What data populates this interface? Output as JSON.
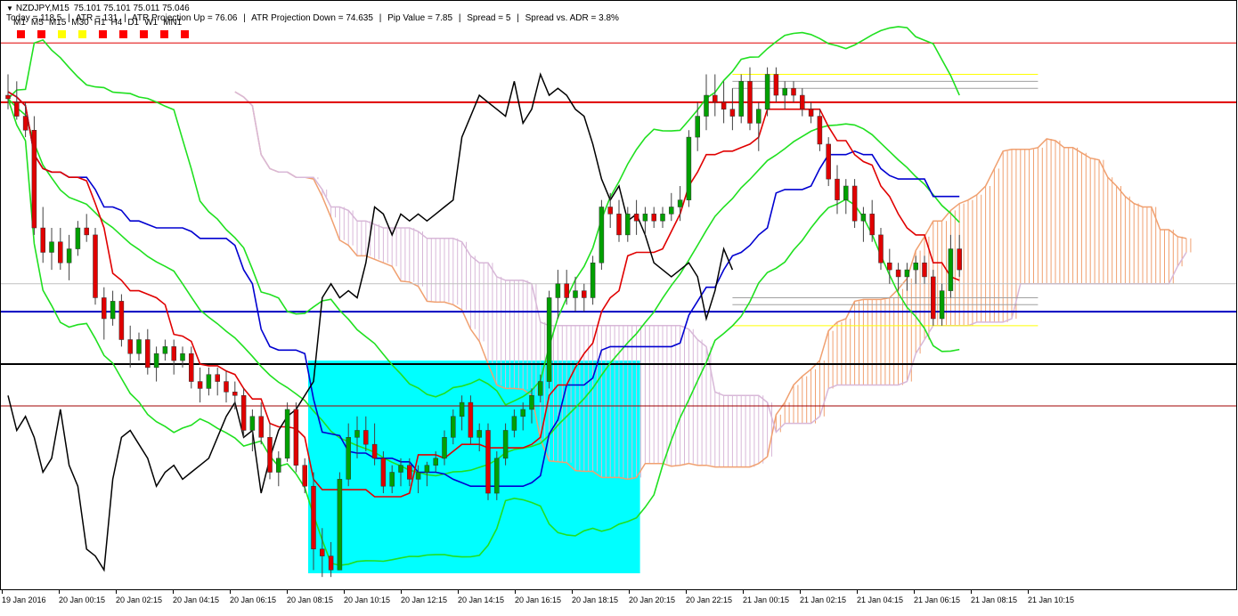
{
  "header": {
    "symbol": "NZDJPY,M15",
    "ohlc": "75.101 75.101 75.011 75.046"
  },
  "stats": {
    "today": "Today = 118.5",
    "atr": "ATR = 131",
    "atr_up": "ATR Projection Up = 76.06",
    "atr_down": "ATR Projection Down = 74.635",
    "pip_value": "Pip Value = 7.85",
    "spread": "Spread = 5",
    "spread_adr": "Spread vs. ADR = 3.8%",
    "separator": "|"
  },
  "timeframes": {
    "labels": [
      "M1",
      "M5",
      "M15",
      "M30",
      "H1",
      "H4",
      "D1",
      "W1",
      "MN1"
    ],
    "colors": [
      "#ff0000",
      "#ff0000",
      "#ffff00",
      "#ffff00",
      "#ff0000",
      "#ff0000",
      "#ff0000",
      "#ff0000",
      "#ff0000"
    ]
  },
  "colors": {
    "bull": "#00a000",
    "bear": "#e00000",
    "kumo_bull": "#f0a070",
    "kumo_bear": "#d8b8d8",
    "kijun": "#0000d0",
    "tenkan": "#e00000",
    "bands": "#20e020",
    "chikou": "#000000",
    "box": "#00ffff"
  },
  "chart_data": {
    "type": "candlestick",
    "symbol": "NZDJPY",
    "timeframe": "M15",
    "y_range": [
      74.6,
      76.25
    ],
    "x_tick_labels": [
      "19 Jan 2016",
      "20 Jan 00:15",
      "20 Jan 02:15",
      "20 Jan 04:15",
      "20 Jan 06:15",
      "20 Jan 08:15",
      "20 Jan 10:15",
      "20 Jan 12:15",
      "20 Jan 14:15",
      "20 Jan 16:15",
      "20 Jan 18:15",
      "20 Jan 20:15",
      "20 Jan 22:15",
      "21 Jan 00:15",
      "21 Jan 02:15",
      "21 Jan 04:15",
      "21 Jan 06:15",
      "21 Jan 08:15",
      "21 Jan 10:15"
    ],
    "candles": [
      {
        "o": 76.0,
        "h": 76.06,
        "l": 75.96,
        "c": 75.99
      },
      {
        "o": 75.98,
        "h": 76.04,
        "l": 75.93,
        "c": 75.94
      },
      {
        "o": 75.94,
        "h": 75.98,
        "l": 75.88,
        "c": 75.9
      },
      {
        "o": 75.9,
        "h": 75.94,
        "l": 75.6,
        "c": 75.62
      },
      {
        "o": 75.62,
        "h": 75.68,
        "l": 75.52,
        "c": 75.55
      },
      {
        "o": 75.55,
        "h": 75.62,
        "l": 75.5,
        "c": 75.58
      },
      {
        "o": 75.58,
        "h": 75.62,
        "l": 75.5,
        "c": 75.52
      },
      {
        "o": 75.52,
        "h": 75.6,
        "l": 75.47,
        "c": 75.56
      },
      {
        "o": 75.56,
        "h": 75.64,
        "l": 75.54,
        "c": 75.62
      },
      {
        "o": 75.62,
        "h": 75.66,
        "l": 75.58,
        "c": 75.6
      },
      {
        "o": 75.6,
        "h": 75.62,
        "l": 75.4,
        "c": 75.42
      },
      {
        "o": 75.42,
        "h": 75.45,
        "l": 75.3,
        "c": 75.36
      },
      {
        "o": 75.36,
        "h": 75.44,
        "l": 75.34,
        "c": 75.41
      },
      {
        "o": 75.41,
        "h": 75.43,
        "l": 75.28,
        "c": 75.3
      },
      {
        "o": 75.3,
        "h": 75.34,
        "l": 75.22,
        "c": 75.26
      },
      {
        "o": 75.26,
        "h": 75.32,
        "l": 75.24,
        "c": 75.3
      },
      {
        "o": 75.3,
        "h": 75.33,
        "l": 75.2,
        "c": 75.22
      },
      {
        "o": 75.22,
        "h": 75.28,
        "l": 75.18,
        "c": 75.26
      },
      {
        "o": 75.26,
        "h": 75.3,
        "l": 75.24,
        "c": 75.28
      },
      {
        "o": 75.28,
        "h": 75.3,
        "l": 75.2,
        "c": 75.24
      },
      {
        "o": 75.24,
        "h": 75.28,
        "l": 75.22,
        "c": 75.26
      },
      {
        "o": 75.26,
        "h": 75.28,
        "l": 75.16,
        "c": 75.18
      },
      {
        "o": 75.18,
        "h": 75.22,
        "l": 75.12,
        "c": 75.16
      },
      {
        "o": 75.16,
        "h": 75.22,
        "l": 75.14,
        "c": 75.2
      },
      {
        "o": 75.2,
        "h": 75.22,
        "l": 75.14,
        "c": 75.18
      },
      {
        "o": 75.18,
        "h": 75.21,
        "l": 75.12,
        "c": 75.15
      },
      {
        "o": 75.15,
        "h": 75.18,
        "l": 75.1,
        "c": 75.14
      },
      {
        "o": 75.14,
        "h": 75.16,
        "l": 75.02,
        "c": 75.04
      },
      {
        "o": 75.04,
        "h": 75.1,
        "l": 74.98,
        "c": 75.08
      },
      {
        "o": 75.08,
        "h": 75.12,
        "l": 75.0,
        "c": 75.02
      },
      {
        "o": 75.02,
        "h": 75.06,
        "l": 74.9,
        "c": 74.92
      },
      {
        "o": 74.92,
        "h": 74.98,
        "l": 74.88,
        "c": 74.96
      },
      {
        "o": 74.96,
        "h": 75.12,
        "l": 74.95,
        "c": 75.1
      },
      {
        "o": 75.1,
        "h": 75.12,
        "l": 74.92,
        "c": 74.94
      },
      {
        "o": 74.94,
        "h": 74.96,
        "l": 74.86,
        "c": 74.88
      },
      {
        "o": 74.88,
        "h": 74.92,
        "l": 74.64,
        "c": 74.7
      },
      {
        "o": 74.7,
        "h": 74.76,
        "l": 74.62,
        "c": 74.68
      },
      {
        "o": 74.68,
        "h": 74.72,
        "l": 74.62,
        "c": 74.64
      },
      {
        "o": 74.64,
        "h": 74.92,
        "l": 74.64,
        "c": 74.9
      },
      {
        "o": 74.9,
        "h": 75.06,
        "l": 74.88,
        "c": 75.02
      },
      {
        "o": 75.02,
        "h": 75.08,
        "l": 74.96,
        "c": 75.04
      },
      {
        "o": 75.04,
        "h": 75.08,
        "l": 74.98,
        "c": 75.0
      },
      {
        "o": 75.0,
        "h": 75.06,
        "l": 74.94,
        "c": 74.96
      },
      {
        "o": 74.96,
        "h": 74.98,
        "l": 74.86,
        "c": 74.88
      },
      {
        "o": 74.88,
        "h": 74.94,
        "l": 74.86,
        "c": 74.92
      },
      {
        "o": 74.92,
        "h": 74.96,
        "l": 74.88,
        "c": 74.94
      },
      {
        "o": 74.94,
        "h": 74.96,
        "l": 74.88,
        "c": 74.9
      },
      {
        "o": 74.9,
        "h": 74.94,
        "l": 74.86,
        "c": 74.92
      },
      {
        "o": 74.92,
        "h": 74.95,
        "l": 74.88,
        "c": 74.94
      },
      {
        "o": 74.94,
        "h": 74.98,
        "l": 74.92,
        "c": 74.96
      },
      {
        "o": 74.96,
        "h": 75.04,
        "l": 74.94,
        "c": 75.02
      },
      {
        "o": 75.02,
        "h": 75.1,
        "l": 75.0,
        "c": 75.08
      },
      {
        "o": 75.08,
        "h": 75.14,
        "l": 75.04,
        "c": 75.12
      },
      {
        "o": 75.12,
        "h": 75.14,
        "l": 75.0,
        "c": 75.02
      },
      {
        "o": 75.02,
        "h": 75.06,
        "l": 74.98,
        "c": 75.04
      },
      {
        "o": 75.04,
        "h": 75.06,
        "l": 74.84,
        "c": 74.86
      },
      {
        "o": 74.86,
        "h": 74.98,
        "l": 74.84,
        "c": 74.96
      },
      {
        "o": 74.96,
        "h": 75.06,
        "l": 74.94,
        "c": 75.04
      },
      {
        "o": 75.04,
        "h": 75.1,
        "l": 75.02,
        "c": 75.08
      },
      {
        "o": 75.08,
        "h": 75.12,
        "l": 75.04,
        "c": 75.1
      },
      {
        "o": 75.1,
        "h": 75.16,
        "l": 75.06,
        "c": 75.14
      },
      {
        "o": 75.14,
        "h": 75.2,
        "l": 75.12,
        "c": 75.18
      },
      {
        "o": 75.18,
        "h": 75.44,
        "l": 75.16,
        "c": 75.42
      },
      {
        "o": 75.42,
        "h": 75.5,
        "l": 75.36,
        "c": 75.46
      },
      {
        "o": 75.46,
        "h": 75.5,
        "l": 75.4,
        "c": 75.42
      },
      {
        "o": 75.42,
        "h": 75.48,
        "l": 75.38,
        "c": 75.44
      },
      {
        "o": 75.44,
        "h": 75.46,
        "l": 75.38,
        "c": 75.42
      },
      {
        "o": 75.42,
        "h": 75.54,
        "l": 75.4,
        "c": 75.52
      },
      {
        "o": 75.52,
        "h": 75.7,
        "l": 75.5,
        "c": 75.68
      },
      {
        "o": 75.68,
        "h": 75.72,
        "l": 75.62,
        "c": 75.66
      },
      {
        "o": 75.66,
        "h": 75.7,
        "l": 75.58,
        "c": 75.6
      },
      {
        "o": 75.6,
        "h": 75.68,
        "l": 75.58,
        "c": 75.66
      },
      {
        "o": 75.66,
        "h": 75.7,
        "l": 75.6,
        "c": 75.64
      },
      {
        "o": 75.64,
        "h": 75.68,
        "l": 75.6,
        "c": 75.66
      },
      {
        "o": 75.66,
        "h": 75.68,
        "l": 75.62,
        "c": 75.64
      },
      {
        "o": 75.64,
        "h": 75.68,
        "l": 75.62,
        "c": 75.66
      },
      {
        "o": 75.66,
        "h": 75.72,
        "l": 75.64,
        "c": 75.68
      },
      {
        "o": 75.68,
        "h": 75.74,
        "l": 75.64,
        "c": 75.7
      },
      {
        "o": 75.7,
        "h": 75.9,
        "l": 75.68,
        "c": 75.88
      },
      {
        "o": 75.88,
        "h": 75.98,
        "l": 75.84,
        "c": 75.94
      },
      {
        "o": 75.94,
        "h": 76.06,
        "l": 75.9,
        "c": 76.0
      },
      {
        "o": 76.0,
        "h": 76.06,
        "l": 75.94,
        "c": 75.98
      },
      {
        "o": 75.98,
        "h": 76.04,
        "l": 75.92,
        "c": 75.96
      },
      {
        "o": 75.96,
        "h": 76.02,
        "l": 75.9,
        "c": 75.94
      },
      {
        "o": 75.94,
        "h": 76.06,
        "l": 75.92,
        "c": 76.04
      },
      {
        "o": 76.04,
        "h": 76.08,
        "l": 75.9,
        "c": 75.92
      },
      {
        "o": 75.92,
        "h": 75.98,
        "l": 75.84,
        "c": 75.96
      },
      {
        "o": 75.96,
        "h": 76.08,
        "l": 75.94,
        "c": 76.06
      },
      {
        "o": 76.06,
        "h": 76.08,
        "l": 75.98,
        "c": 76.0
      },
      {
        "o": 76.0,
        "h": 76.04,
        "l": 75.96,
        "c": 76.02
      },
      {
        "o": 76.02,
        "h": 76.04,
        "l": 75.98,
        "c": 76.0
      },
      {
        "o": 76.0,
        "h": 76.02,
        "l": 75.94,
        "c": 75.96
      },
      {
        "o": 75.96,
        "h": 75.98,
        "l": 75.92,
        "c": 75.94
      },
      {
        "o": 75.94,
        "h": 75.96,
        "l": 75.84,
        "c": 75.86
      },
      {
        "o": 75.86,
        "h": 75.88,
        "l": 75.74,
        "c": 75.76
      },
      {
        "o": 75.76,
        "h": 75.8,
        "l": 75.66,
        "c": 75.7
      },
      {
        "o": 75.7,
        "h": 75.76,
        "l": 75.66,
        "c": 75.74
      },
      {
        "o": 75.74,
        "h": 75.76,
        "l": 75.62,
        "c": 75.64
      },
      {
        "o": 75.64,
        "h": 75.68,
        "l": 75.58,
        "c": 75.66
      },
      {
        "o": 75.66,
        "h": 75.7,
        "l": 75.58,
        "c": 75.6
      },
      {
        "o": 75.6,
        "h": 75.62,
        "l": 75.5,
        "c": 75.52
      },
      {
        "o": 75.52,
        "h": 75.56,
        "l": 75.46,
        "c": 75.5
      },
      {
        "o": 75.5,
        "h": 75.52,
        "l": 75.44,
        "c": 75.48
      },
      {
        "o": 75.48,
        "h": 75.52,
        "l": 75.44,
        "c": 75.5
      },
      {
        "o": 75.5,
        "h": 75.54,
        "l": 75.46,
        "c": 75.52
      },
      {
        "o": 75.52,
        "h": 75.54,
        "l": 75.46,
        "c": 75.48
      },
      {
        "o": 75.48,
        "h": 75.5,
        "l": 75.34,
        "c": 75.36
      },
      {
        "o": 75.36,
        "h": 75.46,
        "l": 75.34,
        "c": 75.44
      },
      {
        "o": 75.44,
        "h": 75.6,
        "l": 75.42,
        "c": 75.56
      },
      {
        "o": 75.56,
        "h": 75.6,
        "l": 75.48,
        "c": 75.5
      }
    ],
    "horizontal_lines": [
      {
        "name": "red-level-upper",
        "price": 76.15,
        "color": "#e00000",
        "width": 1
      },
      {
        "name": "red-level-main",
        "price": 75.98,
        "color": "#e00000",
        "width": 2
      },
      {
        "name": "blue-level",
        "price": 75.38,
        "color": "#0000c0",
        "width": 2
      },
      {
        "name": "black-level",
        "price": 75.23,
        "color": "#000000",
        "width": 2
      },
      {
        "name": "red-level-lower",
        "price": 75.11,
        "color": "#a00000",
        "width": 1
      },
      {
        "name": "grey-level",
        "price": 75.46,
        "color": "#c0c0c0",
        "width": 1
      }
    ],
    "projection_lines": [
      {
        "price": 76.06,
        "color": "#ffff00"
      },
      {
        "price": 76.04,
        "color": "#a0a0a0"
      },
      {
        "price": 76.02,
        "color": "#a0a0a0"
      },
      {
        "price": 75.42,
        "color": "#a0a0a0"
      },
      {
        "price": 75.4,
        "color": "#a0a0a0"
      },
      {
        "price": 75.34,
        "color": "#ffff00"
      }
    ],
    "legend": "none",
    "grid": false
  }
}
